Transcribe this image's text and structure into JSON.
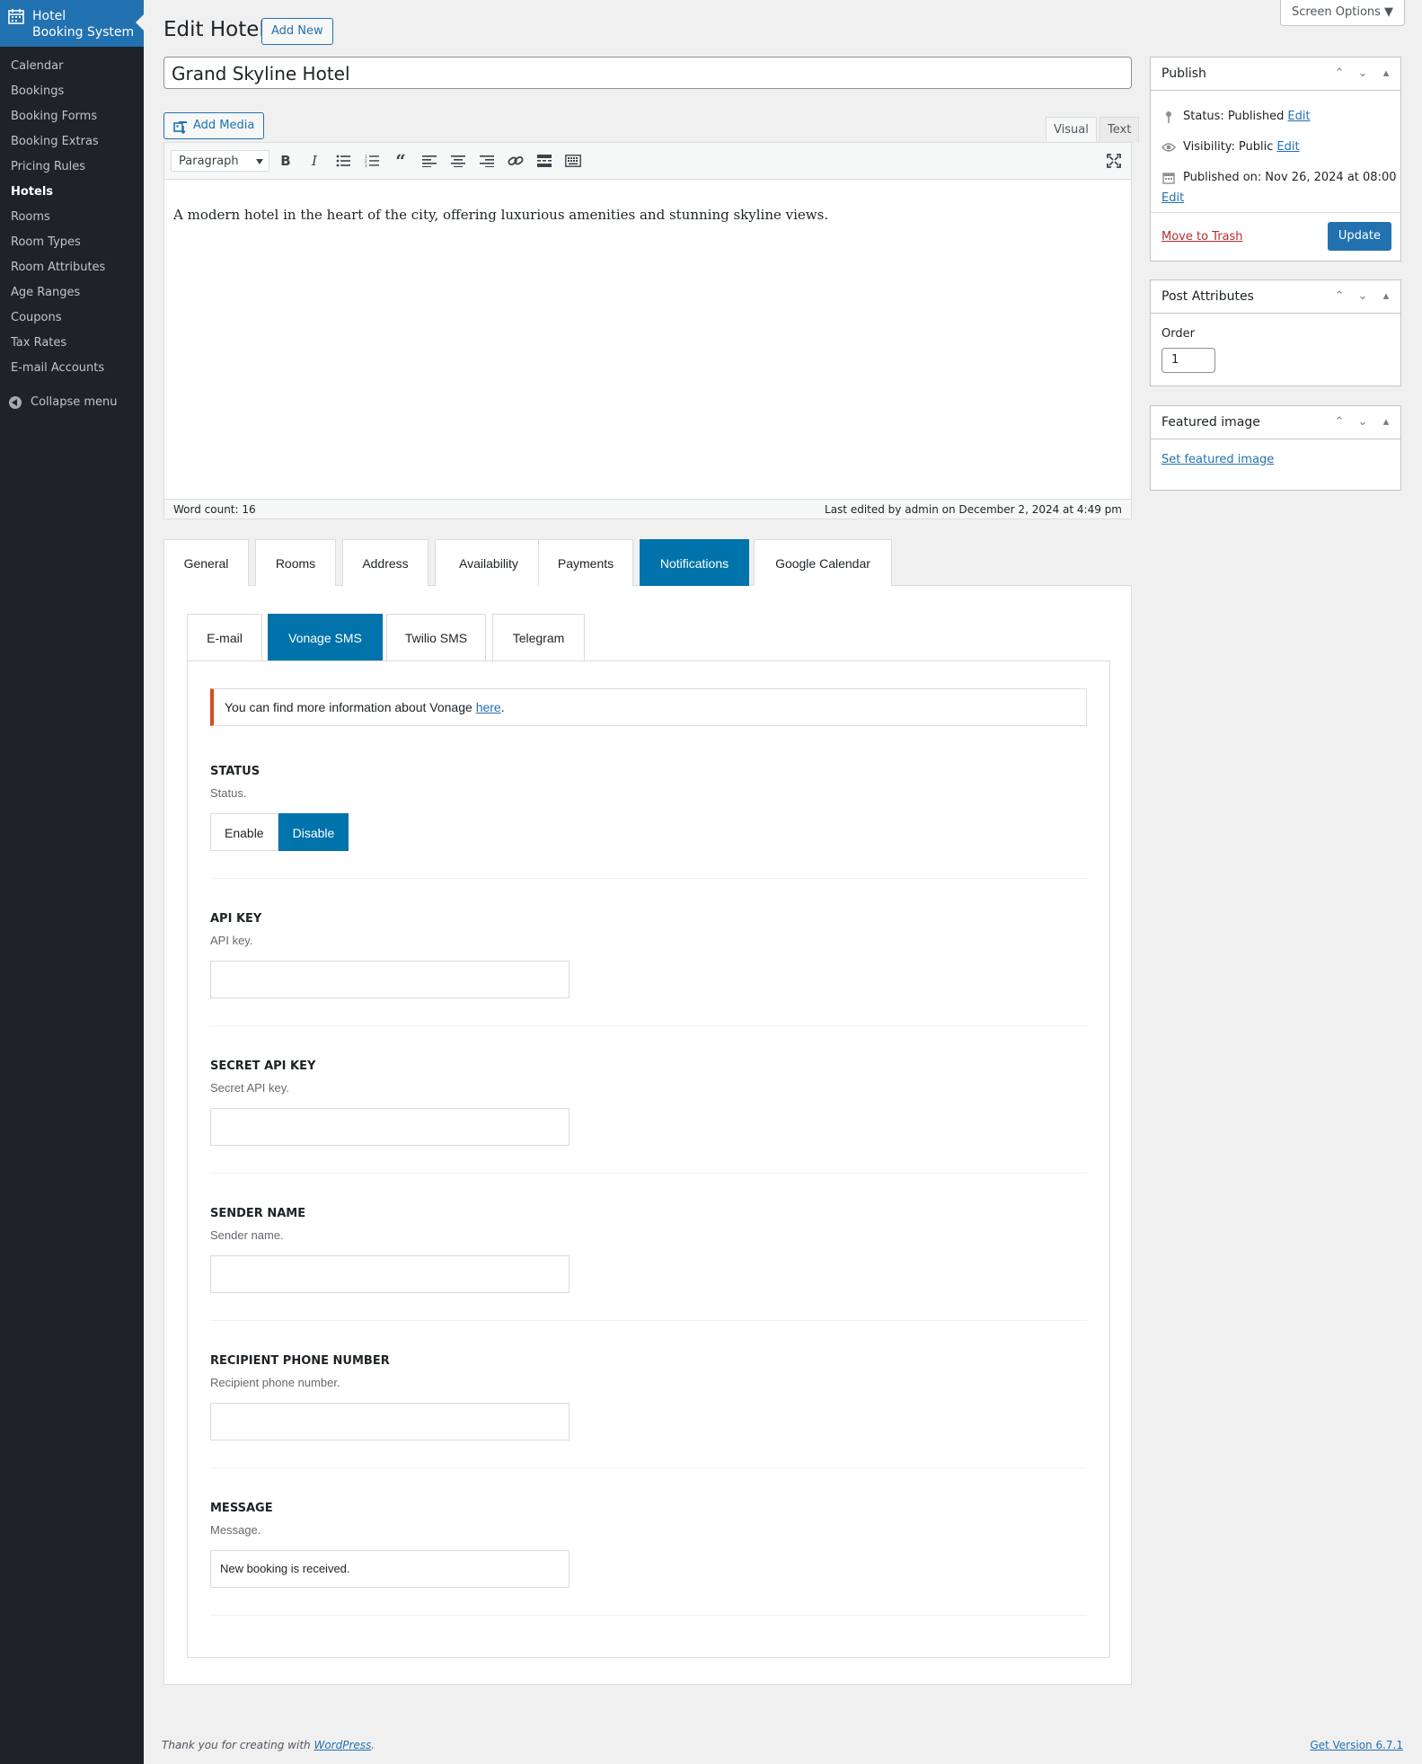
{
  "sidebar": {
    "brand": "Hotel\nBooking System",
    "brand_line1": "Hotel",
    "brand_line2": "Booking System",
    "items": [
      {
        "label": "Calendar"
      },
      {
        "label": "Bookings"
      },
      {
        "label": "Booking Forms"
      },
      {
        "label": "Booking Extras"
      },
      {
        "label": "Pricing Rules"
      },
      {
        "label": "Hotels",
        "active": true
      },
      {
        "label": "Rooms"
      },
      {
        "label": "Room Types"
      },
      {
        "label": "Room Attributes"
      },
      {
        "label": "Age Ranges"
      },
      {
        "label": "Coupons"
      },
      {
        "label": "Tax Rates"
      },
      {
        "label": "E-mail Accounts"
      }
    ],
    "collapse": "Collapse menu"
  },
  "header": {
    "title": "Edit Hotel",
    "add_new": "Add New",
    "screen_options": "Screen Options ▼"
  },
  "post": {
    "title": "Grand Skyline Hotel"
  },
  "editor": {
    "add_media": "Add Media",
    "tab_visual": "Visual",
    "tab_text": "Text",
    "format": "Paragraph",
    "content": "A modern hotel in the heart of the city, offering luxurious amenities and stunning skyline views.",
    "word_count": "Word count: 16",
    "last_edited": "Last edited by admin on December 2, 2024 at 4:49 pm"
  },
  "publish": {
    "title": "Publish",
    "status_label": "Status:",
    "status_value": "Published",
    "visibility_label": "Visibility:",
    "visibility_value": "Public",
    "published_label": "Published on:",
    "published_value": "Nov 26, 2024 at 08:00",
    "edit": "Edit",
    "trash": "Move to Trash",
    "update": "Update"
  },
  "attributes": {
    "title": "Post Attributes",
    "order_label": "Order",
    "order_value": "1"
  },
  "featured": {
    "title": "Featured image",
    "link": "Set featured image"
  },
  "settings": {
    "main_tabs": [
      "General",
      "Rooms",
      "Address",
      "Availability",
      "Payments",
      "Notifications",
      "Google Calendar"
    ],
    "selected_main_tab": "Notifications",
    "sub_tabs": [
      "E-mail",
      "Vonage SMS",
      "Twilio SMS",
      "Telegram"
    ],
    "selected_sub_tab": "Vonage SMS",
    "notice_text": "You can find more information about Vonage ",
    "notice_link": "here",
    "notice_end": ".",
    "status": {
      "label": "STATUS",
      "desc": "Status.",
      "enable": "Enable",
      "disable": "Disable",
      "selected": "Disable"
    },
    "api_key": {
      "label": "API KEY",
      "desc": "API key.",
      "value": ""
    },
    "secret_api_key": {
      "label": "SECRET API KEY",
      "desc": "Secret API key.",
      "value": ""
    },
    "sender_name": {
      "label": "SENDER NAME",
      "desc": "Sender name.",
      "value": ""
    },
    "recipient": {
      "label": "RECIPIENT PHONE NUMBER",
      "desc": "Recipient phone number.",
      "value": ""
    },
    "message": {
      "label": "MESSAGE",
      "desc": "Message.",
      "value": "New booking is received."
    }
  },
  "footer": {
    "text": "Thank you for creating with ",
    "link": "WordPress",
    "end": ".",
    "version": "Get Version 6.7.1"
  },
  "colors": {
    "accent": "#2271b1",
    "tab_selected": "#0073aa",
    "sidebar_bg": "#1d2327",
    "notice_border": "#d54e21"
  }
}
